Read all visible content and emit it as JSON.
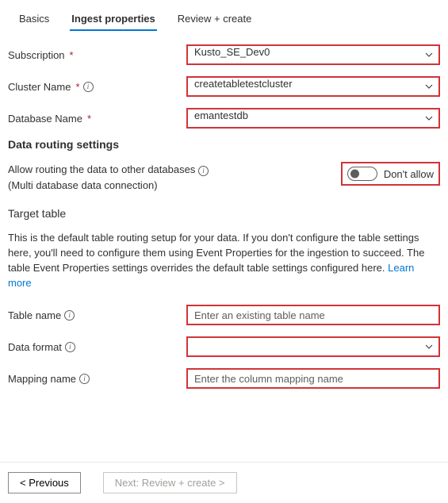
{
  "tabs": {
    "basics": "Basics",
    "ingest": "Ingest properties",
    "review": "Review + create"
  },
  "fields": {
    "subscription": {
      "label": "Subscription",
      "value": "Kusto_SE_Dev0"
    },
    "cluster": {
      "label": "Cluster Name",
      "value": "createtabletestcluster"
    },
    "database": {
      "label": "Database Name",
      "value": "emantestdb"
    }
  },
  "routing": {
    "heading": "Data routing settings",
    "allow_label": "Allow routing the data to other databases",
    "allow_sub": "(Multi database data connection)",
    "toggle_text": "Don't allow"
  },
  "target": {
    "heading": "Target table",
    "desc_a": "This is the default table routing setup for your data. If you don't configure the table settings here, you'll need to configure them using Event Properties for the ingestion to succeed. The table Event Properties settings overrides the default table settings configured here. ",
    "learn": "Learn more",
    "table_name": {
      "label": "Table name",
      "placeholder": "Enter an existing table name"
    },
    "data_format": {
      "label": "Data format",
      "value": ""
    },
    "mapping": {
      "label": "Mapping name",
      "placeholder": "Enter the column mapping name"
    }
  },
  "footer": {
    "prev": "< Previous",
    "next": "Next: Review + create >"
  }
}
